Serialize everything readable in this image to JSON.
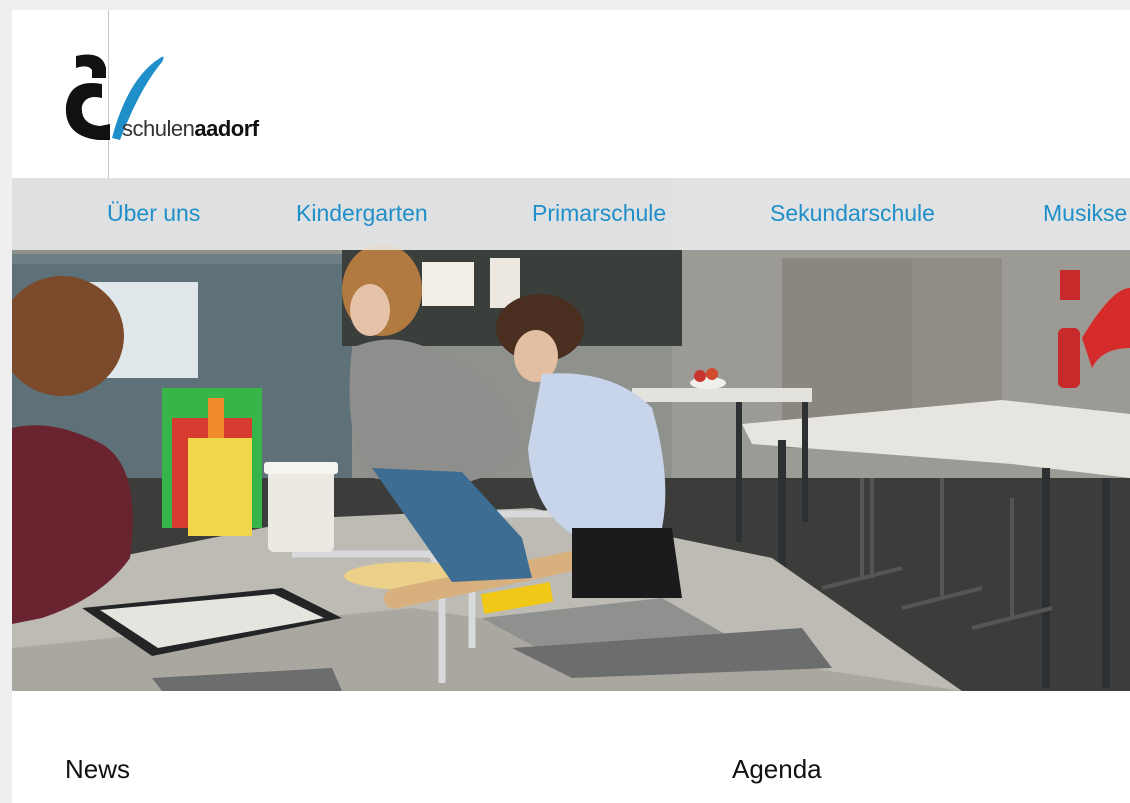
{
  "logo": {
    "text_light": "schulen",
    "text_bold": "aadorf",
    "accent_color": "#1f8fc9"
  },
  "nav": {
    "items": [
      {
        "label": "Über uns"
      },
      {
        "label": "Kindergarten"
      },
      {
        "label": "Primarschule"
      },
      {
        "label": "Sekundarschule"
      },
      {
        "label": "Musikse"
      }
    ],
    "link_color": "#1f8fc9"
  },
  "hero": {
    "image": "students-in-school-kitchen"
  },
  "sections": {
    "news_title": "News",
    "agenda_title": "Agenda"
  }
}
